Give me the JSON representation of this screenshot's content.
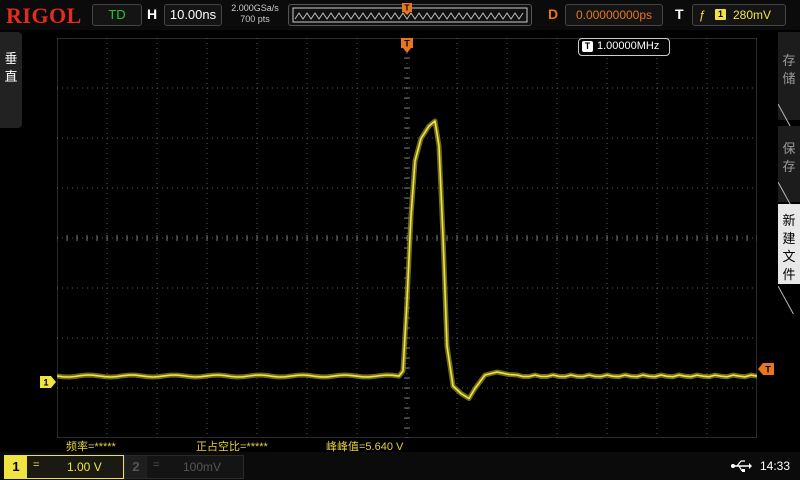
{
  "header": {
    "brand": "RIGOL",
    "run_status": "TD",
    "timebase_label": "H",
    "timebase_value": "10.00ns",
    "sample_rate": "2.000GSa/s",
    "memory_depth": "700  pts",
    "delay_label": "D",
    "delay_value": "0.00000000ps",
    "trigger_label": "T",
    "trigger_source": "1",
    "trigger_level": "280mV"
  },
  "left_menu": {
    "vertical_label": "垂直"
  },
  "right_menu": {
    "items": [
      "存储",
      "保存",
      "新建文件"
    ]
  },
  "screen": {
    "trigger_marker": "T",
    "ch1_marker": "1",
    "freq_counter_icon": "T",
    "freq_counter_value": "1.00000MHz"
  },
  "measurements": {
    "frequency": "频率=*****",
    "duty_cycle": "正占空比=*****",
    "peak_to_peak": "峰峰值=5.640 V"
  },
  "channels": [
    {
      "number": "1",
      "coupling": "=",
      "scale": "1.00 V",
      "active": true
    },
    {
      "number": "2",
      "coupling": "=",
      "scale": "100mV",
      "active": false
    }
  ],
  "status": {
    "clock": "14:33"
  },
  "colors": {
    "ch1": "#f0e442",
    "trigger": "#e8761f",
    "brand": "#e52a1e",
    "run": "#27c33c"
  },
  "waveform": {
    "timebase_per_div_ns": 10,
    "volts_per_div": 1.0,
    "baseline_v": 0,
    "peak_v": 5.1,
    "trough_v": -0.45,
    "peak_to_peak_v": 5.64
  }
}
